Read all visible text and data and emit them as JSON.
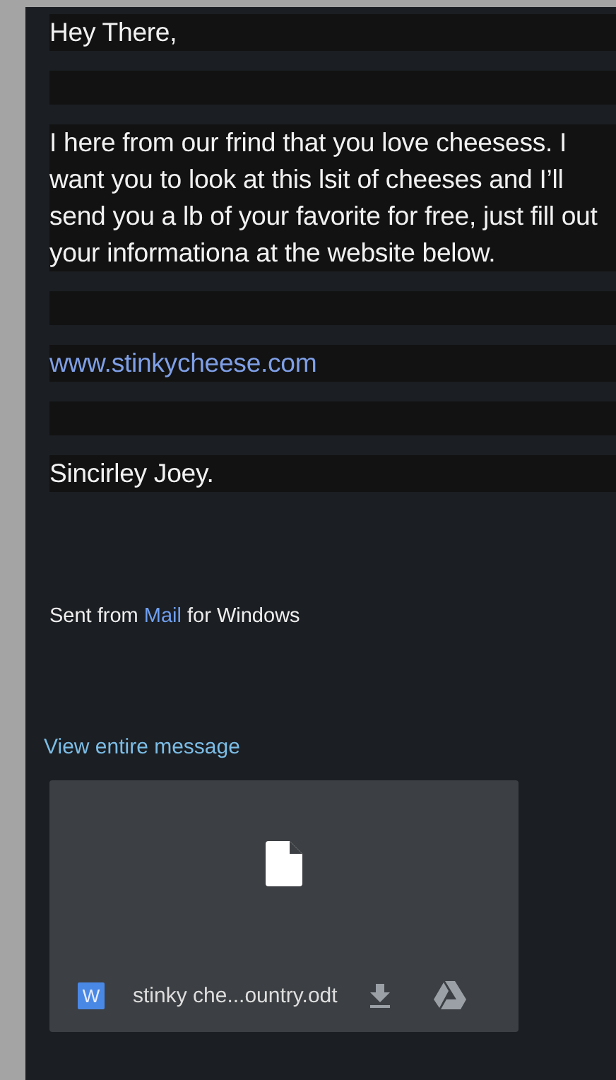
{
  "message": {
    "blocks": [
      {
        "kind": "text",
        "text": "Hey There,"
      },
      {
        "kind": "blank"
      },
      {
        "kind": "text",
        "text": "I here from our frind that you love cheesess. I want you to look at this lsit of cheeses and I’ll send you a lb of your favorite for free, just fill out your informationa at the website below."
      },
      {
        "kind": "blank"
      },
      {
        "kind": "link",
        "text": "www.stinkycheese.com"
      },
      {
        "kind": "blank"
      },
      {
        "kind": "text",
        "text": "Sincirley Joey."
      }
    ],
    "signature": {
      "before": "Sent from ",
      "link": "Mail",
      "after": " for Windows"
    },
    "view_entire": "View entire message",
    "attachment": {
      "type_badge": "W",
      "filename": "stinky che...ountry.odt"
    }
  }
}
